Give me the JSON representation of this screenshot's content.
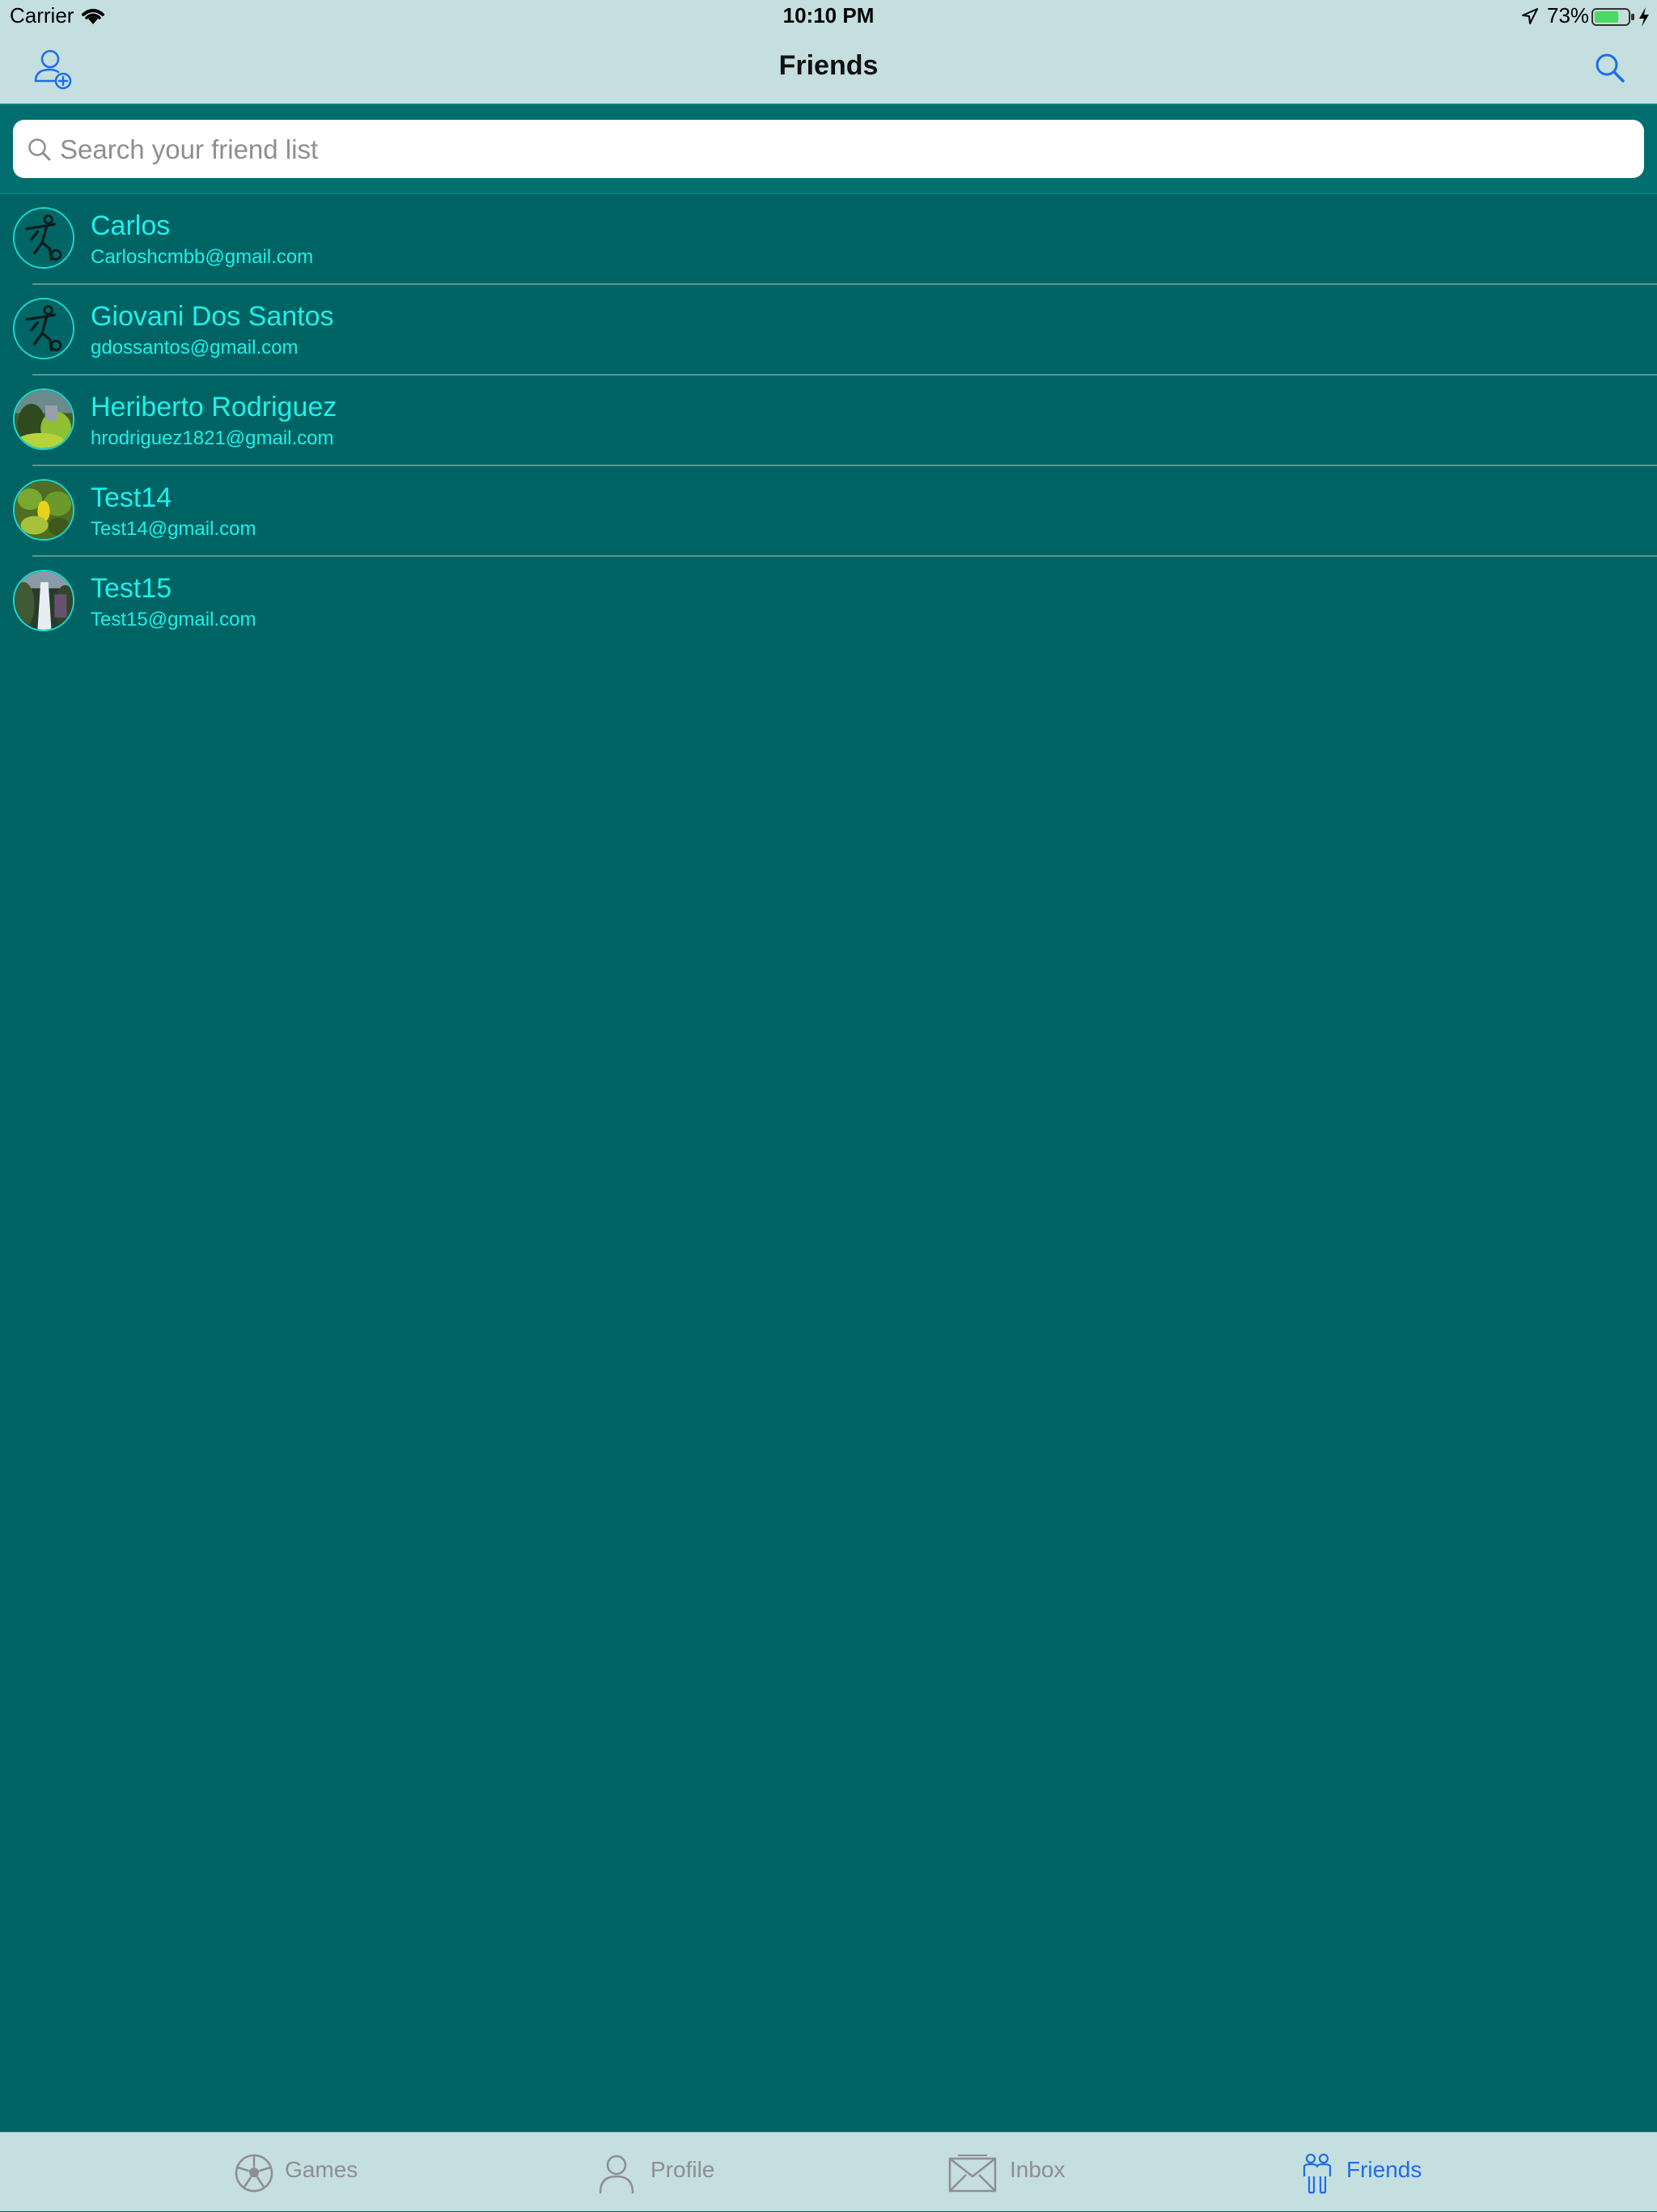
{
  "status": {
    "carrier": "Carrier",
    "time": "10:10 PM",
    "battery": "73%",
    "battery_level": 0.73
  },
  "nav": {
    "title": "Friends"
  },
  "search": {
    "placeholder": "Search your friend list",
    "value": ""
  },
  "friends": [
    {
      "name": "Carlos",
      "email": "Carloshcmbb@gmail.com",
      "avatar": "soccer-player-icon"
    },
    {
      "name": "Giovani Dos Santos",
      "email": "gdossantos@gmail.com",
      "avatar": "soccer-player-icon"
    },
    {
      "name": "Heriberto Rodriguez",
      "email": "hrodriguez1821@gmail.com",
      "avatar": "photo"
    },
    {
      "name": "Test14",
      "email": "Test14@gmail.com",
      "avatar": "photo"
    },
    {
      "name": "Test15",
      "email": "Test15@gmail.com",
      "avatar": "photo"
    }
  ],
  "tabs": [
    {
      "label": "Games",
      "icon": "soccer-ball-icon",
      "active": false
    },
    {
      "label": "Profile",
      "icon": "person-icon",
      "active": false
    },
    {
      "label": "Inbox",
      "icon": "envelope-icon",
      "active": false
    },
    {
      "label": "Friends",
      "icon": "friends-icon",
      "active": true
    }
  ],
  "colors": {
    "background": "#006363",
    "bars": "#c5dedf",
    "text_accent": "#1ef0ea",
    "tab_active": "#1e6ee8",
    "tab_inactive": "#8e8e93"
  }
}
